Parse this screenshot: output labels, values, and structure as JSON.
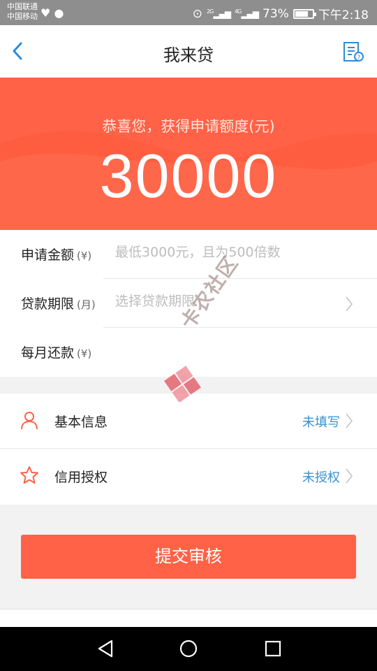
{
  "status_bar": {
    "carrier_1": "中国联通",
    "carrier_2": "中国移动",
    "network_2g": "2G",
    "network_4g": "4G",
    "battery": "73%",
    "time": "下午2:18"
  },
  "nav": {
    "title": "我来贷"
  },
  "hero": {
    "subtitle": "恭喜您，获得申请额度(元)",
    "amount": "30000"
  },
  "form": {
    "rows": [
      {
        "label": "申请金额",
        "unit": "(¥)",
        "placeholder": "最低3000元，且为500倍数"
      },
      {
        "label": "贷款期限",
        "unit": "(月)",
        "placeholder": "选择贷款期限"
      },
      {
        "label": "每月还款",
        "unit": "(¥)",
        "placeholder": ""
      }
    ]
  },
  "info": {
    "rows": [
      {
        "label": "基本信息",
        "status": "未填写",
        "icon": "person-icon"
      },
      {
        "label": "信用授权",
        "status": "未授权",
        "icon": "star-icon"
      }
    ]
  },
  "submit_label": "提交审核",
  "watermark": "卡农社区",
  "colors": {
    "accent": "#ff6247",
    "status_blue": "#3a8fd0",
    "nav_icon_blue": "#2a8de0"
  }
}
